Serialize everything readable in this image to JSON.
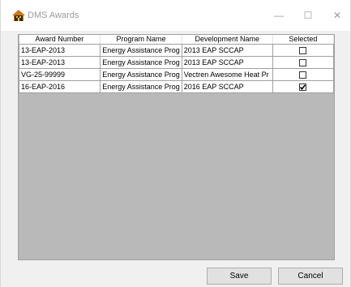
{
  "window": {
    "title": "DMS Awards",
    "minimize_glyph": "—",
    "maximize_glyph": "☐",
    "close_glyph": "✕"
  },
  "grid": {
    "headers": [
      "Award Number",
      "Program Name",
      "Development Name",
      "Selected"
    ],
    "rows": [
      {
        "award": "13-EAP-2013",
        "program": "Energy Assistance Prog",
        "development": "2013 EAP SCCAP",
        "selected": false
      },
      {
        "award": "13-EAP-2013",
        "program": "Energy Assistance Prog",
        "development": "2013 EAP SCCAP",
        "selected": false
      },
      {
        "award": "VG-25-99999",
        "program": "Energy Assistance Prog",
        "development": "Vectren Awesome Heat Pr",
        "selected": false
      },
      {
        "award": "16-EAP-2016",
        "program": "Energy Assistance Prog",
        "development": "2016 EAP SCCAP",
        "selected": true
      }
    ]
  },
  "buttons": {
    "save_label": "Save",
    "cancel_label": "Cancel"
  },
  "colors": {
    "grid_background": "#b9b9b9",
    "window_background": "#f0f0f0",
    "button_face": "#e1e1e1"
  }
}
